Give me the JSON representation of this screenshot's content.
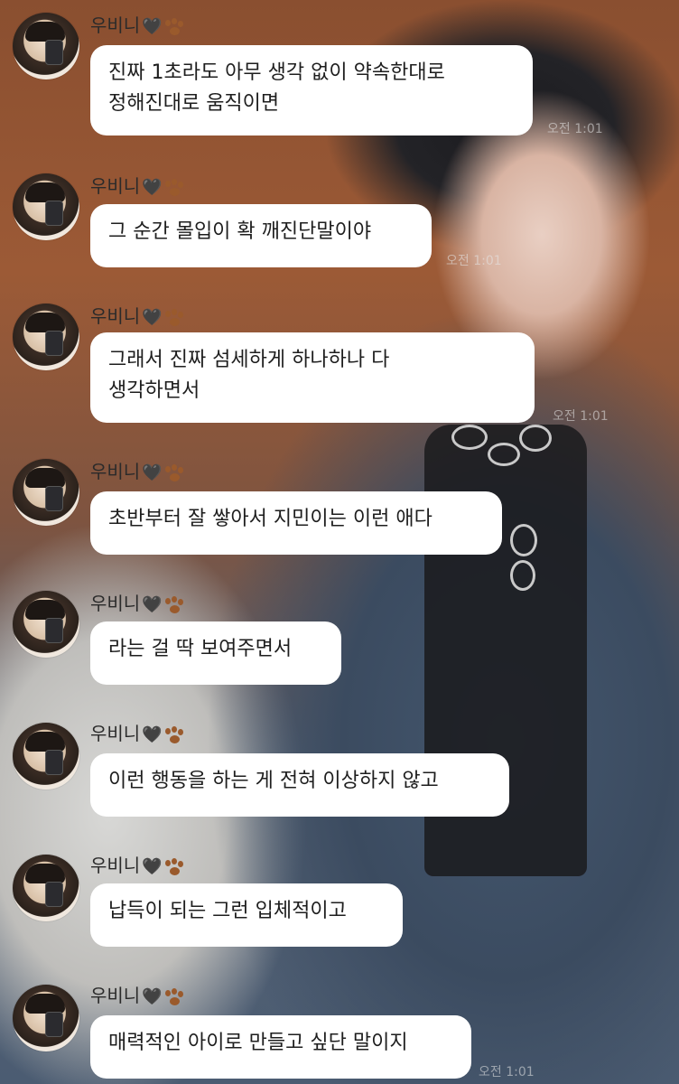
{
  "sender": {
    "name": "우비니",
    "heart": "🖤",
    "paw_icon": "paw-icon"
  },
  "messages": [
    {
      "text": "진짜 1초라도 아무 생각 없이 약속한대로\n정해진대로 움직이면",
      "time": "오전 1:01"
    },
    {
      "text": "그 순간 몰입이 확 깨진단말이야",
      "time": "오전 1:01"
    },
    {
      "text": "그래서 진짜 섬세하게 하나하나 다\n생각하면서",
      "time": "오전 1:01"
    },
    {
      "text": "초반부터 잘 쌓아서 지민이는 이런 애다",
      "time": ""
    },
    {
      "text": "라는 걸 딱 보여주면서",
      "time": ""
    },
    {
      "text": "이런 행동을 하는 게 전혀 이상하지 않고",
      "time": ""
    },
    {
      "text": "납득이 되는 그런 입체적이고",
      "time": ""
    },
    {
      "text": "매력적인 아이로 만들고 싶단 말이지",
      "time": "오전 1:01"
    }
  ]
}
